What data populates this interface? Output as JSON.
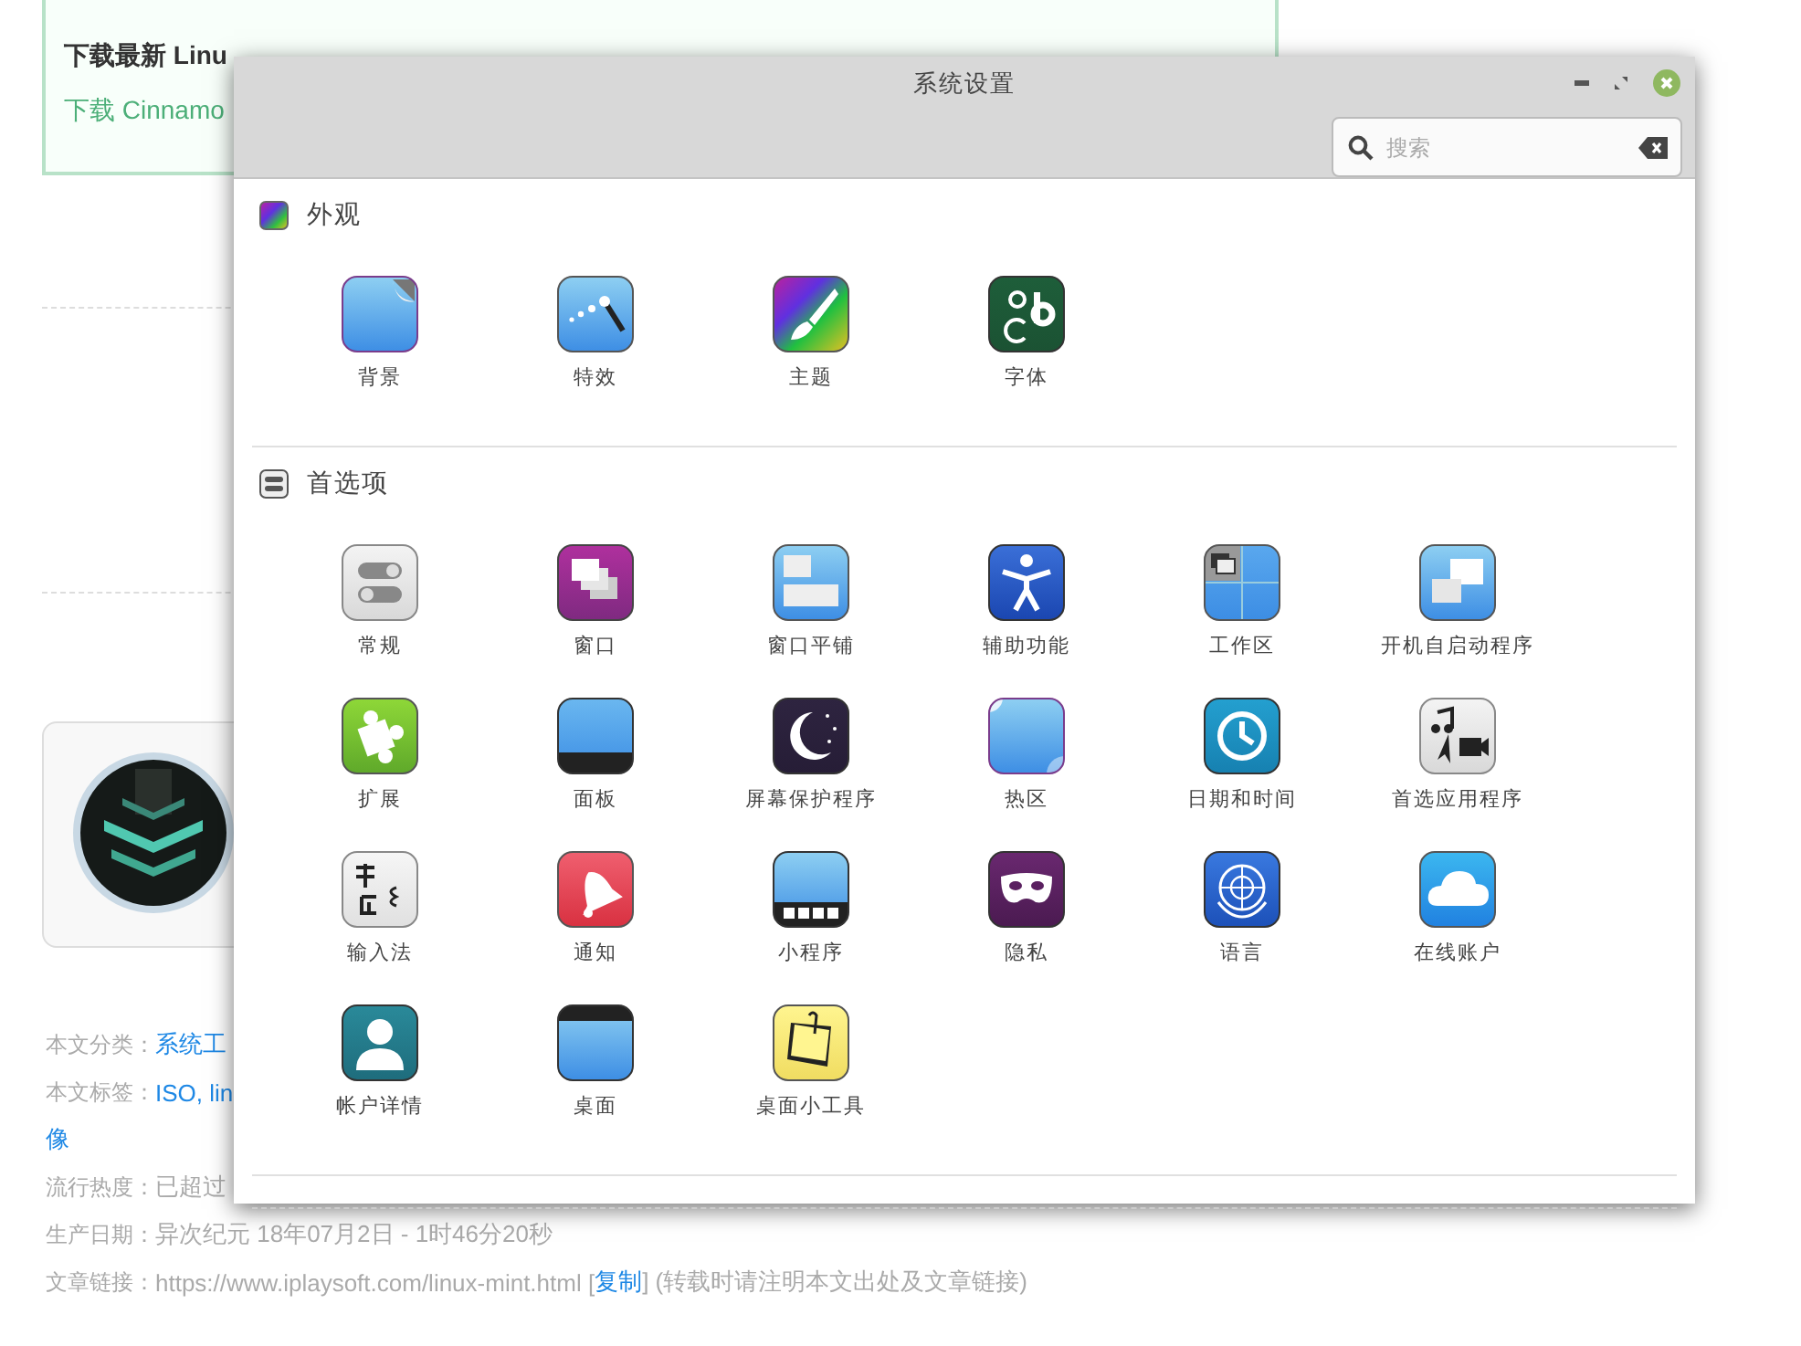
{
  "background_page": {
    "download_box": {
      "heading": "下载最新 Linu",
      "link": "下载 Cinnamo"
    },
    "meta": [
      {
        "label": "本文分类：",
        "parts": [
          {
            "text": "系统工",
            "kind": "link"
          }
        ]
      },
      {
        "label": "本文标签：",
        "parts": [
          {
            "text": "ISO, lin",
            "kind": "link"
          }
        ]
      },
      {
        "parts": [
          {
            "text": "像",
            "kind": "link"
          }
        ]
      },
      {
        "label": "流行热度：",
        "parts": [
          {
            "text": "已超过",
            "kind": "plain"
          }
        ]
      },
      {
        "label": "生产日期：",
        "parts": [
          {
            "text": "异次纪元 18年07月2日 - 1时46分20秒",
            "kind": "plain"
          }
        ]
      },
      {
        "label": "文章链接：",
        "parts": [
          {
            "text": "https://www.iplaysoft.com/linux-mint.html [",
            "kind": "plain"
          },
          {
            "text": "复制",
            "kind": "link"
          },
          {
            "text": "] (转载时请注明本文出处及文章链接)",
            "kind": "plain"
          }
        ]
      }
    ]
  },
  "window": {
    "title": "系统设置",
    "search": {
      "placeholder": "搜索"
    },
    "sections": [
      {
        "title": "外观",
        "items": [
          {
            "label": "背景"
          },
          {
            "label": "特效"
          },
          {
            "label": "主题"
          },
          {
            "label": "字体"
          }
        ]
      },
      {
        "title": "首选项",
        "items": [
          {
            "label": "常规"
          },
          {
            "label": "窗口"
          },
          {
            "label": "窗口平铺"
          },
          {
            "label": "辅助功能"
          },
          {
            "label": "工作区"
          },
          {
            "label": "开机自启动程序"
          },
          {
            "label": "扩展"
          },
          {
            "label": "面板"
          },
          {
            "label": "屏幕保护程序"
          },
          {
            "label": "热区"
          },
          {
            "label": "日期和时间"
          },
          {
            "label": "首选应用程序"
          },
          {
            "label": "输入法"
          },
          {
            "label": "通知"
          },
          {
            "label": "小程序"
          },
          {
            "label": "隐私"
          },
          {
            "label": "语言"
          },
          {
            "label": "在线账户"
          },
          {
            "label": "帐户详情"
          },
          {
            "label": "桌面"
          },
          {
            "label": "桌面小工具"
          }
        ]
      }
    ]
  }
}
